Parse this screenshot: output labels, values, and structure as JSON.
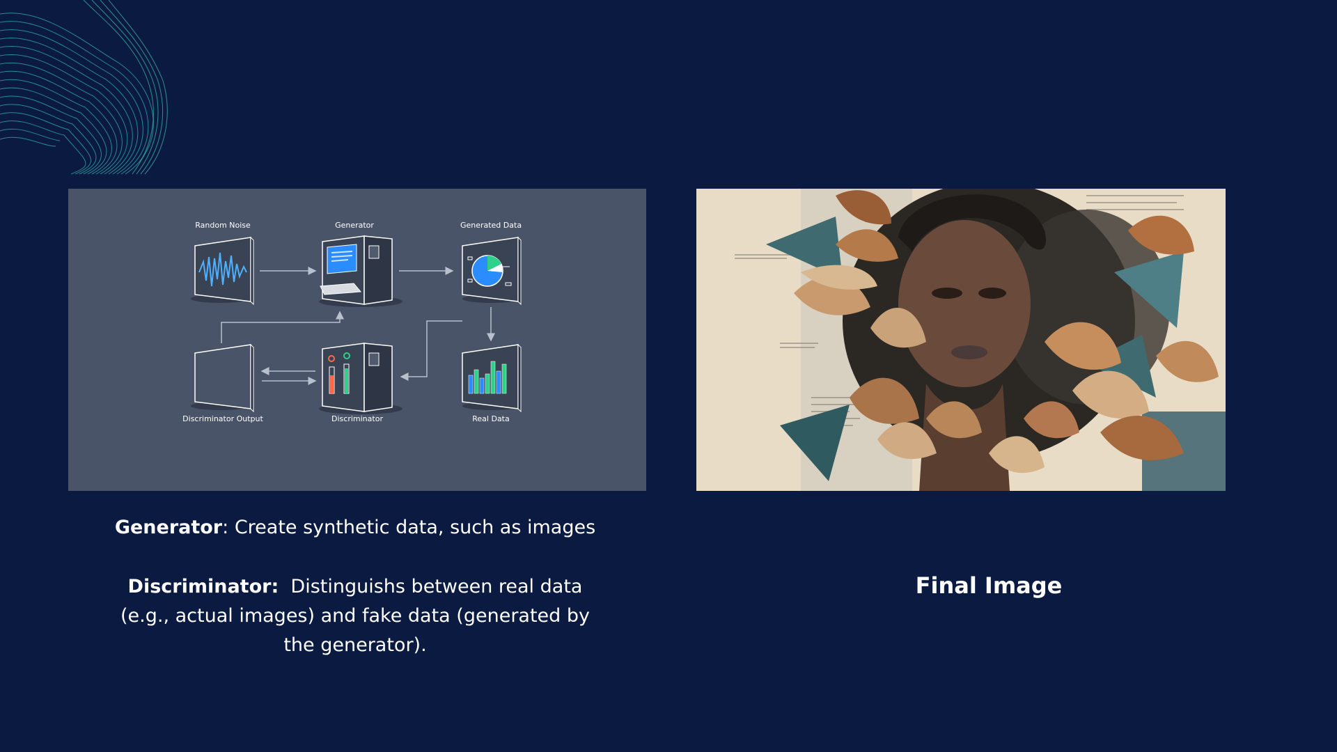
{
  "diagram": {
    "labels": {
      "random_noise": "Random Noise",
      "generator": "Generator",
      "generated_data": "Generated Data",
      "discriminator_output": "Discriminator Output",
      "discriminator": "Discriminator",
      "real_data": "Real Data"
    }
  },
  "captions": {
    "generator_term": "Generator",
    "generator_text": ": Create synthetic data, such as images",
    "discriminator_term": "Discriminator:",
    "discriminator_text": "  Distinguishs between real data (e.g., actual images) and fake data (generated by the generator)."
  },
  "final_image": {
    "title": "Final Image"
  },
  "colors": {
    "background": "#0a1a40",
    "panel": "#4a5468",
    "accent_teal": "#3fd0c0",
    "accent_blue": "#2a8cff"
  }
}
